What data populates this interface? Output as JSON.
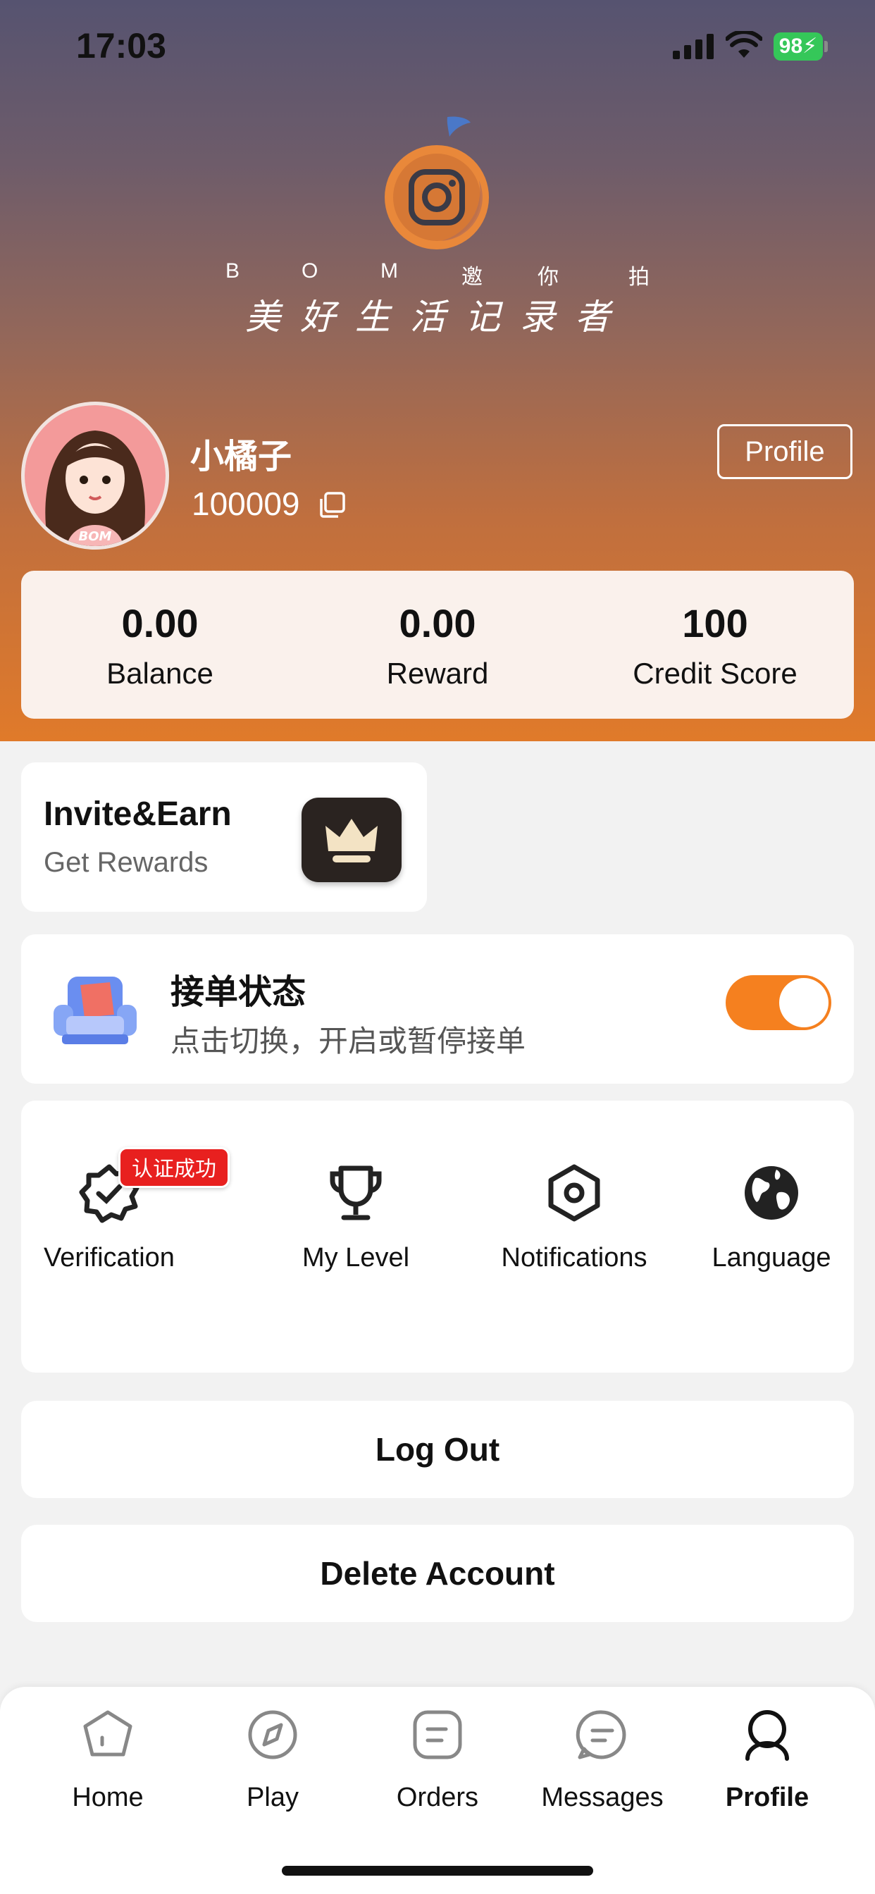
{
  "status_bar": {
    "time": "17:03",
    "battery": "98"
  },
  "brand": {
    "letters": [
      "B",
      "O",
      "M",
      "邀",
      "你",
      "拍"
    ],
    "slogan": "美好生活记录者"
  },
  "user": {
    "name": "小橘子",
    "id": "100009",
    "profile_button": "Profile",
    "avatar_text": "BOM"
  },
  "stats": [
    {
      "value": "0.00",
      "label": "Balance"
    },
    {
      "value": "0.00",
      "label": "Reward"
    },
    {
      "value": "100",
      "label": "Credit Score"
    }
  ],
  "invite": {
    "title": "Invite&Earn",
    "subtitle": "Get Rewards"
  },
  "order_status": {
    "title": "接单状态",
    "subtitle": "点击切换，开启或暂停接单",
    "enabled": true
  },
  "features": {
    "verification": {
      "label": "Verification",
      "badge": "认证成功"
    },
    "level": {
      "label": "My Level"
    },
    "notifications": {
      "label": "Notifications"
    },
    "language": {
      "label": "Language"
    }
  },
  "actions": {
    "logout": "Log Out",
    "delete": "Delete Account"
  },
  "tabs": [
    {
      "label": "Home",
      "icon": "home-pentagon-icon"
    },
    {
      "label": "Play",
      "icon": "compass-icon"
    },
    {
      "label": "Orders",
      "icon": "orders-icon"
    },
    {
      "label": "Messages",
      "icon": "messages-icon"
    },
    {
      "label": "Profile",
      "icon": "profile-icon",
      "active": true
    }
  ],
  "colors": {
    "accent": "#F5801F",
    "badge": "#E8201F",
    "battery": "#35C759"
  }
}
